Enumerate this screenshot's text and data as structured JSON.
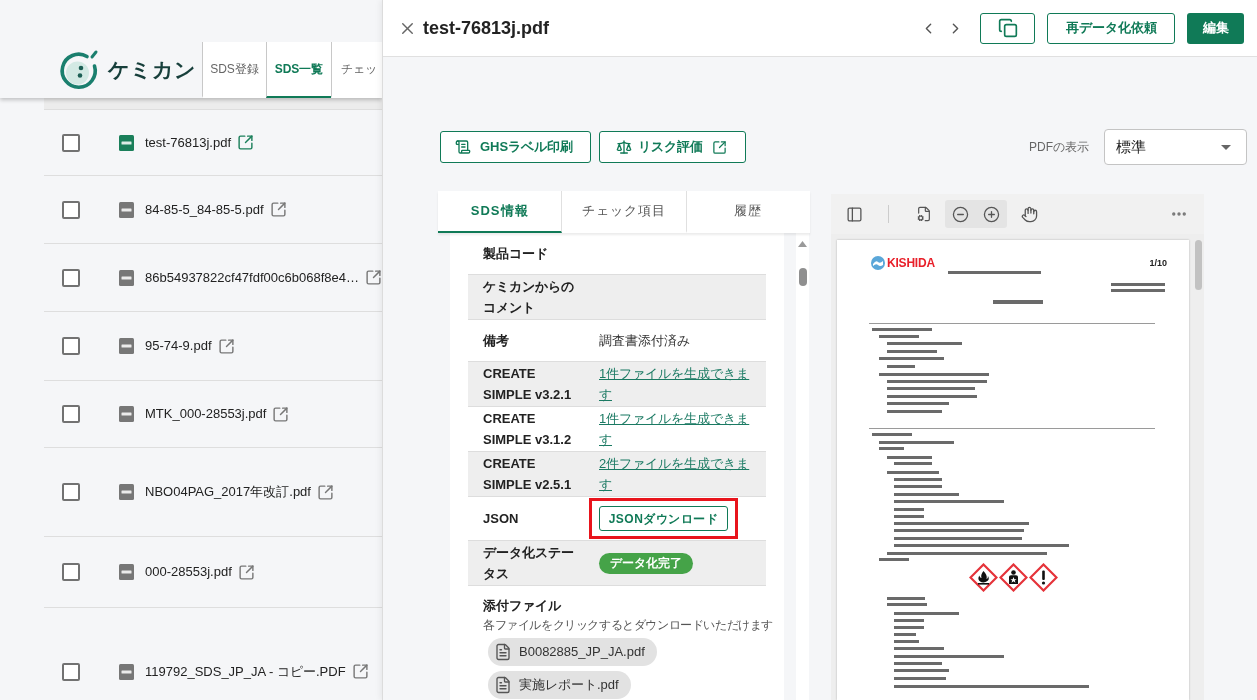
{
  "app_header": {
    "logo_text": "ケミカン",
    "nav_tabs": [
      {
        "label": "SDS登録",
        "selected": false
      },
      {
        "label": "SDS一覧",
        "selected": true
      },
      {
        "label": "チェッ",
        "selected": false
      }
    ]
  },
  "file_list": [
    {
      "name": "test-76813j.pdf",
      "checked": false,
      "selected": true
    },
    {
      "name": "84-85-5_84-85-5.pdf",
      "checked": false,
      "selected": false
    },
    {
      "name": "86b54937822cf47fdf00c6b068f8e4…",
      "checked": false,
      "selected": false
    },
    {
      "name": "95-74-9.pdf",
      "checked": false,
      "selected": false
    },
    {
      "name": "MTK_000-28553j.pdf",
      "checked": false,
      "selected": false
    },
    {
      "name": "NBO04PAG_2017年改訂.pdf",
      "checked": false,
      "selected": false
    },
    {
      "name": "000-28553j.pdf",
      "checked": false,
      "selected": false
    },
    {
      "name": "119792_SDS_JP_JA - コピー.PDF",
      "checked": false,
      "selected": false
    }
  ],
  "drawer": {
    "title": "test-76813j.pdf",
    "actions": [
      {
        "kind": "copy"
      },
      {
        "kind": "outline",
        "label": "再データ化依頼"
      },
      {
        "kind": "primary",
        "label": "編集"
      }
    ],
    "tools": [
      {
        "kind": "label_print",
        "label": "GHSラベル印刷"
      },
      {
        "kind": "external",
        "label": "リスク評価"
      }
    ],
    "pdf_display": {
      "label": "PDFの表示",
      "value": "標準"
    },
    "info_tabs": [
      {
        "label": "SDS情報",
        "selected": true
      },
      {
        "label": "チェック項目",
        "selected": false
      },
      {
        "label": "履歴",
        "selected": false
      }
    ],
    "info_rows": [
      {
        "label": "製品コード",
        "kind": "text",
        "highlighted": false
      },
      {
        "label": "ケミカンからのコメント",
        "kind": "text",
        "highlighted": false
      },
      {
        "label": "備考",
        "kind": "text",
        "value": "調査書添付済み",
        "highlighted": false
      },
      {
        "label": "CREATE SIMPLE v3.2.1",
        "kind": "link",
        "value": "1件ファイルを生成できます",
        "highlighted": false
      },
      {
        "label": "CREATE SIMPLE v3.1.2",
        "kind": "link",
        "value": "1件ファイルを生成できます",
        "highlighted": false
      },
      {
        "label": "CREATE SIMPLE v2.5.1",
        "kind": "link",
        "value": "2件ファイルを生成できます",
        "highlighted": false
      },
      {
        "label": "JSON",
        "kind": "button",
        "value": "JSONダウンロード",
        "highlighted": true
      },
      {
        "label": "データ化ステータス",
        "kind": "badge",
        "value": "データ化完了",
        "highlighted": false
      }
    ],
    "attachments": {
      "title": "添付ファイル",
      "hint": "各ファイルをクリックするとダウンロードいただけます",
      "files": [
        {
          "name": "B0082885_JP_JA.pdf"
        },
        {
          "name": "実施レポート.pdf"
        }
      ]
    },
    "pdf_viewer": {
      "page": {
        "logo": "KISHIDA",
        "page_number": "1/10"
      }
    }
  }
}
